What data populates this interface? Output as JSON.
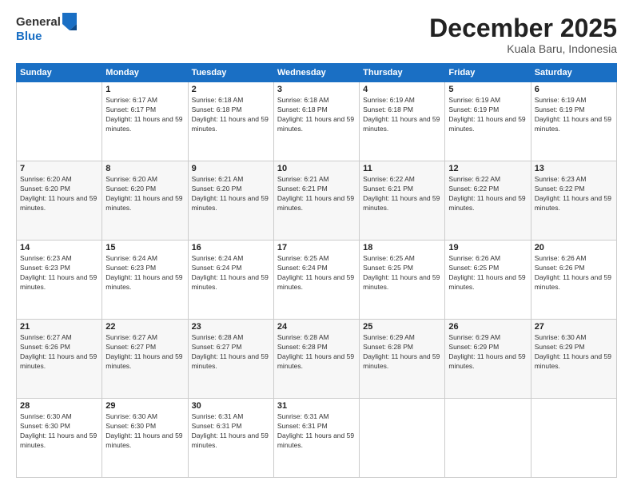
{
  "logo": {
    "general": "General",
    "blue": "Blue"
  },
  "title": "December 2025",
  "location": "Kuala Baru, Indonesia",
  "days_of_week": [
    "Sunday",
    "Monday",
    "Tuesday",
    "Wednesday",
    "Thursday",
    "Friday",
    "Saturday"
  ],
  "weeks": [
    [
      {
        "day": "",
        "sunrise": "",
        "sunset": "",
        "daylight": ""
      },
      {
        "day": "1",
        "sunrise": "Sunrise: 6:17 AM",
        "sunset": "Sunset: 6:17 PM",
        "daylight": "Daylight: 11 hours and 59 minutes."
      },
      {
        "day": "2",
        "sunrise": "Sunrise: 6:18 AM",
        "sunset": "Sunset: 6:18 PM",
        "daylight": "Daylight: 11 hours and 59 minutes."
      },
      {
        "day": "3",
        "sunrise": "Sunrise: 6:18 AM",
        "sunset": "Sunset: 6:18 PM",
        "daylight": "Daylight: 11 hours and 59 minutes."
      },
      {
        "day": "4",
        "sunrise": "Sunrise: 6:19 AM",
        "sunset": "Sunset: 6:18 PM",
        "daylight": "Daylight: 11 hours and 59 minutes."
      },
      {
        "day": "5",
        "sunrise": "Sunrise: 6:19 AM",
        "sunset": "Sunset: 6:19 PM",
        "daylight": "Daylight: 11 hours and 59 minutes."
      },
      {
        "day": "6",
        "sunrise": "Sunrise: 6:19 AM",
        "sunset": "Sunset: 6:19 PM",
        "daylight": "Daylight: 11 hours and 59 minutes."
      }
    ],
    [
      {
        "day": "7",
        "sunrise": "Sunrise: 6:20 AM",
        "sunset": "Sunset: 6:20 PM",
        "daylight": "Daylight: 11 hours and 59 minutes."
      },
      {
        "day": "8",
        "sunrise": "Sunrise: 6:20 AM",
        "sunset": "Sunset: 6:20 PM",
        "daylight": "Daylight: 11 hours and 59 minutes."
      },
      {
        "day": "9",
        "sunrise": "Sunrise: 6:21 AM",
        "sunset": "Sunset: 6:20 PM",
        "daylight": "Daylight: 11 hours and 59 minutes."
      },
      {
        "day": "10",
        "sunrise": "Sunrise: 6:21 AM",
        "sunset": "Sunset: 6:21 PM",
        "daylight": "Daylight: 11 hours and 59 minutes."
      },
      {
        "day": "11",
        "sunrise": "Sunrise: 6:22 AM",
        "sunset": "Sunset: 6:21 PM",
        "daylight": "Daylight: 11 hours and 59 minutes."
      },
      {
        "day": "12",
        "sunrise": "Sunrise: 6:22 AM",
        "sunset": "Sunset: 6:22 PM",
        "daylight": "Daylight: 11 hours and 59 minutes."
      },
      {
        "day": "13",
        "sunrise": "Sunrise: 6:23 AM",
        "sunset": "Sunset: 6:22 PM",
        "daylight": "Daylight: 11 hours and 59 minutes."
      }
    ],
    [
      {
        "day": "14",
        "sunrise": "Sunrise: 6:23 AM",
        "sunset": "Sunset: 6:23 PM",
        "daylight": "Daylight: 11 hours and 59 minutes."
      },
      {
        "day": "15",
        "sunrise": "Sunrise: 6:24 AM",
        "sunset": "Sunset: 6:23 PM",
        "daylight": "Daylight: 11 hours and 59 minutes."
      },
      {
        "day": "16",
        "sunrise": "Sunrise: 6:24 AM",
        "sunset": "Sunset: 6:24 PM",
        "daylight": "Daylight: 11 hours and 59 minutes."
      },
      {
        "day": "17",
        "sunrise": "Sunrise: 6:25 AM",
        "sunset": "Sunset: 6:24 PM",
        "daylight": "Daylight: 11 hours and 59 minutes."
      },
      {
        "day": "18",
        "sunrise": "Sunrise: 6:25 AM",
        "sunset": "Sunset: 6:25 PM",
        "daylight": "Daylight: 11 hours and 59 minutes."
      },
      {
        "day": "19",
        "sunrise": "Sunrise: 6:26 AM",
        "sunset": "Sunset: 6:25 PM",
        "daylight": "Daylight: 11 hours and 59 minutes."
      },
      {
        "day": "20",
        "sunrise": "Sunrise: 6:26 AM",
        "sunset": "Sunset: 6:26 PM",
        "daylight": "Daylight: 11 hours and 59 minutes."
      }
    ],
    [
      {
        "day": "21",
        "sunrise": "Sunrise: 6:27 AM",
        "sunset": "Sunset: 6:26 PM",
        "daylight": "Daylight: 11 hours and 59 minutes."
      },
      {
        "day": "22",
        "sunrise": "Sunrise: 6:27 AM",
        "sunset": "Sunset: 6:27 PM",
        "daylight": "Daylight: 11 hours and 59 minutes."
      },
      {
        "day": "23",
        "sunrise": "Sunrise: 6:28 AM",
        "sunset": "Sunset: 6:27 PM",
        "daylight": "Daylight: 11 hours and 59 minutes."
      },
      {
        "day": "24",
        "sunrise": "Sunrise: 6:28 AM",
        "sunset": "Sunset: 6:28 PM",
        "daylight": "Daylight: 11 hours and 59 minutes."
      },
      {
        "day": "25",
        "sunrise": "Sunrise: 6:29 AM",
        "sunset": "Sunset: 6:28 PM",
        "daylight": "Daylight: 11 hours and 59 minutes."
      },
      {
        "day": "26",
        "sunrise": "Sunrise: 6:29 AM",
        "sunset": "Sunset: 6:29 PM",
        "daylight": "Daylight: 11 hours and 59 minutes."
      },
      {
        "day": "27",
        "sunrise": "Sunrise: 6:30 AM",
        "sunset": "Sunset: 6:29 PM",
        "daylight": "Daylight: 11 hours and 59 minutes."
      }
    ],
    [
      {
        "day": "28",
        "sunrise": "Sunrise: 6:30 AM",
        "sunset": "Sunset: 6:30 PM",
        "daylight": "Daylight: 11 hours and 59 minutes."
      },
      {
        "day": "29",
        "sunrise": "Sunrise: 6:30 AM",
        "sunset": "Sunset: 6:30 PM",
        "daylight": "Daylight: 11 hours and 59 minutes."
      },
      {
        "day": "30",
        "sunrise": "Sunrise: 6:31 AM",
        "sunset": "Sunset: 6:31 PM",
        "daylight": "Daylight: 11 hours and 59 minutes."
      },
      {
        "day": "31",
        "sunrise": "Sunrise: 6:31 AM",
        "sunset": "Sunset: 6:31 PM",
        "daylight": "Daylight: 11 hours and 59 minutes."
      },
      {
        "day": "",
        "sunrise": "",
        "sunset": "",
        "daylight": ""
      },
      {
        "day": "",
        "sunrise": "",
        "sunset": "",
        "daylight": ""
      },
      {
        "day": "",
        "sunrise": "",
        "sunset": "",
        "daylight": ""
      }
    ]
  ]
}
